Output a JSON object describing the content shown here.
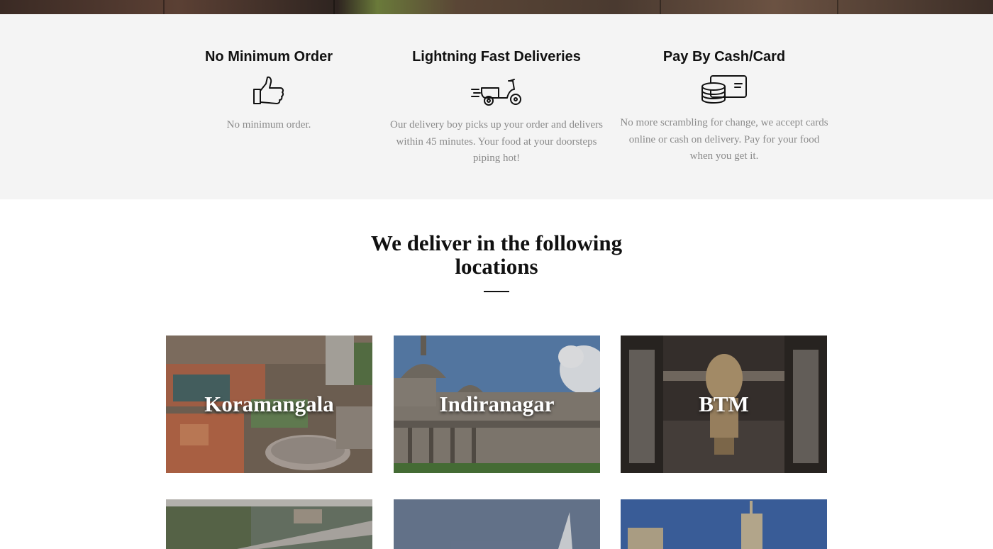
{
  "features": [
    {
      "title": "No Minimum Order",
      "icon": "thumbs-up-icon",
      "description": "No minimum order."
    },
    {
      "title": "Lightning Fast Deliveries",
      "icon": "delivery-scooter-icon",
      "description": "Our delivery boy picks up your order and delivers within 45 minutes. Your food at your doorsteps piping hot!"
    },
    {
      "title": "Pay By Cash/Card",
      "icon": "cash-card-icon",
      "description": "No more scrambling for change, we accept cards online or cash on delivery. Pay for your food when you get it."
    }
  ],
  "locations": {
    "heading": "We deliver in the following locations",
    "items": [
      {
        "label": "Koramangala"
      },
      {
        "label": "Indiranagar"
      },
      {
        "label": "BTM"
      },
      {
        "label": ""
      },
      {
        "label": ""
      },
      {
        "label": ""
      }
    ]
  },
  "colors": {
    "feature_band": "#f4f4f4",
    "body_text": "#8a8a8a",
    "heading": "#111111"
  }
}
